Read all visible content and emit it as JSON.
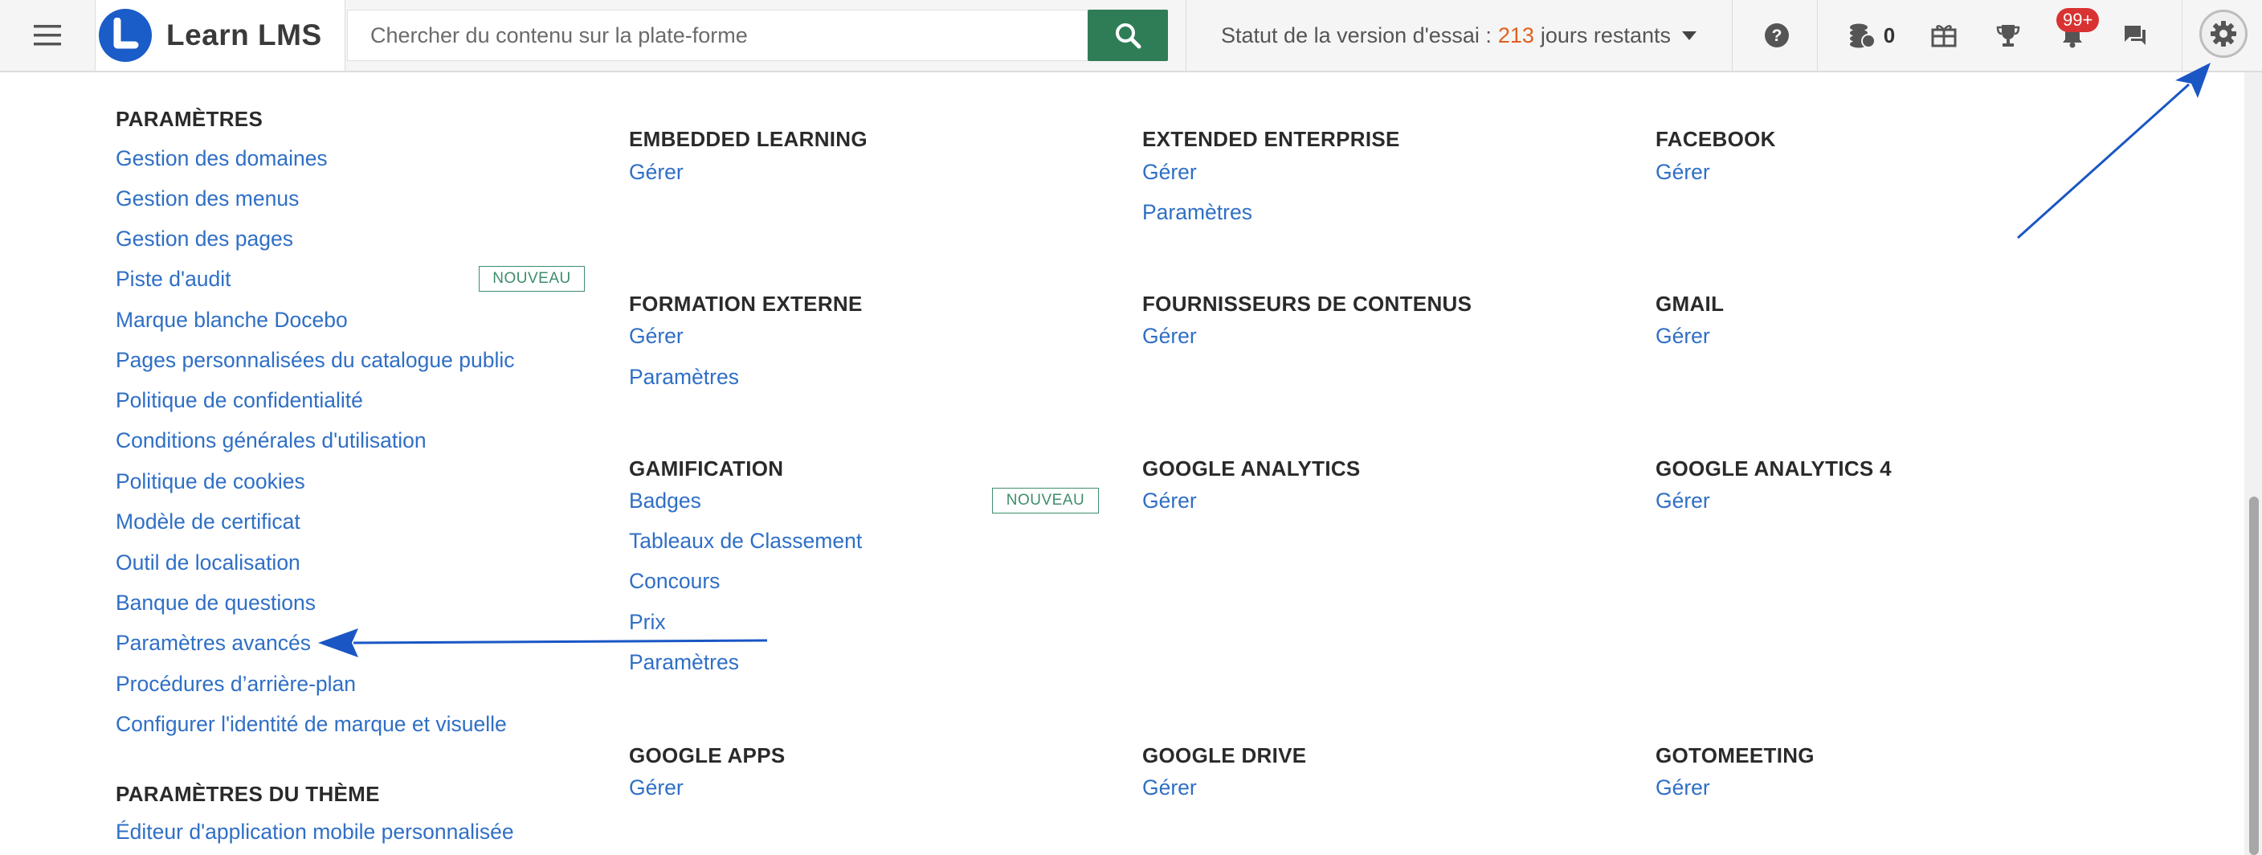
{
  "header": {
    "app_name": "Learn LMS",
    "search_placeholder": "Chercher du contenu sur la plate-forme",
    "trial_label": "Statut de la version d'essai :",
    "trial_days": "213",
    "trial_suffix": "jours restants",
    "coins_count": "0",
    "notifications_badge": "99+",
    "icons": [
      "menu-icon",
      "logo-icon",
      "search-icon",
      "help-icon",
      "coins-icon",
      "gift-icon",
      "trophy-icon",
      "bell-icon",
      "chat-icon",
      "gear-icon"
    ],
    "colors": {
      "brand": "#1a5cc8",
      "search_button": "#2f7d57",
      "trial_days": "#e0601f",
      "badge": "#d93232",
      "link": "#2f6fc5"
    }
  },
  "settings": {
    "title": "PARAMÈTRES",
    "items": [
      "Gestion des domaines",
      "Gestion des menus",
      "Gestion des pages",
      "Piste d'audit",
      "Marque blanche Docebo",
      "Pages personnalisées du catalogue public",
      "Politique de confidentialité",
      "Conditions générales d'utilisation",
      "Politique de cookies",
      "Modèle de certificat",
      "Outil de localisation",
      "Banque de questions",
      "Paramètres avancés",
      "Procédures d’arrière-plan",
      "Configurer l'identité de marque et visuelle"
    ],
    "new_tag": "NOUVEAU",
    "theme_title": "PARAMÈTRES DU THÈME",
    "theme_items": [
      "Éditeur d'application mobile personnalisée"
    ]
  },
  "apps": [
    {
      "title": "EMBEDDED LEARNING",
      "links": [
        "Gérer"
      ]
    },
    {
      "title": "EXTENDED ENTERPRISE",
      "links": [
        "Gérer",
        "Paramètres"
      ]
    },
    {
      "title": "FACEBOOK",
      "links": [
        "Gérer"
      ]
    },
    {
      "title": "FORMATION EXTERNE",
      "links": [
        "Gérer",
        "Paramètres"
      ]
    },
    {
      "title": "FOURNISSEURS DE CONTENUS",
      "links": [
        "Gérer"
      ]
    },
    {
      "title": "GMAIL",
      "links": [
        "Gérer"
      ]
    },
    {
      "title": "GAMIFICATION",
      "links": [
        "Badges",
        "Tableaux de Classement",
        "Concours",
        "Prix",
        "Paramètres"
      ],
      "tag": "NOUVEAU"
    },
    {
      "title": "GOOGLE ANALYTICS",
      "links": [
        "Gérer"
      ]
    },
    {
      "title": "GOOGLE ANALYTICS 4",
      "links": [
        "Gérer"
      ]
    },
    {
      "title": "GOOGLE APPS",
      "links": [
        "Gérer"
      ]
    },
    {
      "title": "GOOGLE DRIVE",
      "links": [
        "Gérer"
      ]
    },
    {
      "title": "GOTOMEETING",
      "links": [
        "Gérer"
      ]
    }
  ]
}
